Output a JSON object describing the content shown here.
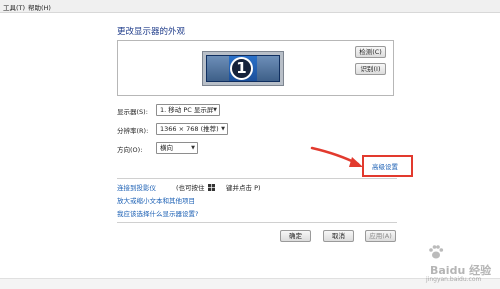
{
  "menubar": {
    "tools": "工具(T)",
    "help": "帮助(H)"
  },
  "page": {
    "title": "更改显示器的外观"
  },
  "preview": {
    "monitor_number": "1",
    "detect_button": "检测(C)",
    "identify_button": "识别(I)"
  },
  "settings": {
    "display_label": "显示器(S):",
    "display_value": "1. 移动 PC 显示屏",
    "resolution_label": "分辨率(R):",
    "resolution_value": "1366 × 768 (推荐)",
    "orientation_label": "方向(O):",
    "orientation_value": "横向",
    "advanced_link": "高级设置"
  },
  "links": {
    "projector": "连接到投影仪",
    "projector_hint": "(也可按住",
    "projector_hint_suffix": "键并点击 P)",
    "text_size": "放大或缩小文本和其他项目",
    "help": "我应该选择什么显示器设置?"
  },
  "footer": {
    "ok": "确定",
    "cancel": "取消",
    "apply": "应用(A)"
  },
  "watermark": {
    "brand": "Baidu 经验",
    "site": "jingyan.baidu.com"
  },
  "colors": {
    "link": "#1a5fb4",
    "title": "#1f3c8a",
    "highlight": "#e23a2e"
  }
}
